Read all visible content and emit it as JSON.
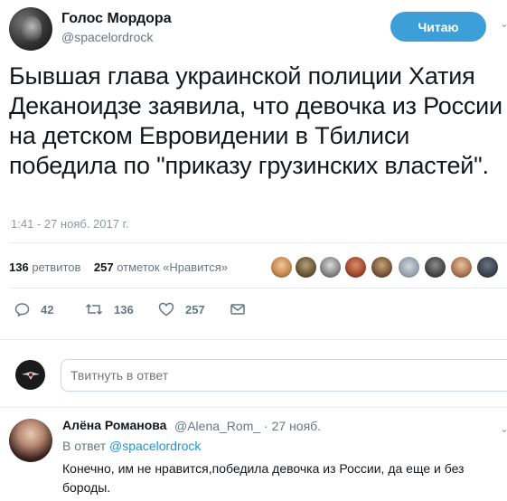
{
  "tweet": {
    "author_name": "Голос Мордора",
    "author_handle": "@spacelordrock",
    "follow_button_label": "Читаю",
    "text": "Бывшая глава украинской полиции Хатия Деканоидзе заявила, что девочка из России на детском Евровидении в Тбилиси победила по \"приказу грузинских властей\".",
    "timestamp": "1:41 - 27 нояб. 2017 г."
  },
  "stats": {
    "retweets_count": "136",
    "retweets_label": "ретвитов",
    "likes_count": "257",
    "likes_label": "отметок «Нравится»"
  },
  "actions": {
    "reply_count": "42",
    "retweet_count": "136",
    "like_count": "257"
  },
  "reply_box": {
    "placeholder": "Твитнуть в ответ"
  },
  "reply": {
    "author_name": "Алёна Романова",
    "author_handle_time": "@Alena_Rom_ · 27 нояб.",
    "reply_to_label": "В ответ",
    "reply_to_handle": "@spacelordrock",
    "text": "Конечно, им не нравится,победила девочка из России, да еще и без бороды."
  },
  "colors": {
    "accent": "#1b95e0",
    "follow_button": "#3d9fd8",
    "muted": "#657786"
  }
}
